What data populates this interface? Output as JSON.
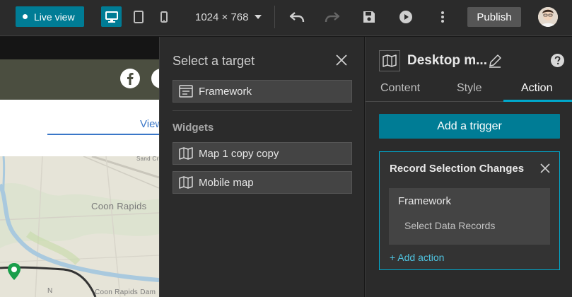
{
  "topbar": {
    "live_view_label": "Live view",
    "screen_size_label": "1024 × 768",
    "publish_label": "Publish"
  },
  "canvas": {
    "nav_link_label": "View",
    "map_labels": {
      "coon_rapids": "Coon Rapids",
      "sand_creek": "Sand Cr",
      "coon_rapids_dam": "Coon Rapids Dam",
      "n_marker": "N"
    }
  },
  "target_panel": {
    "title": "Select a target",
    "framework_item": "Framework",
    "widgets_heading": "Widgets",
    "widgets": [
      {
        "label": "Map 1 copy copy"
      },
      {
        "label": "Mobile map"
      }
    ]
  },
  "settings": {
    "title": "Desktop m...",
    "tabs": [
      {
        "label": "Content"
      },
      {
        "label": "Style"
      },
      {
        "label": "Action"
      }
    ],
    "active_tab": "Action",
    "add_trigger_label": "Add a trigger",
    "trigger": {
      "title": "Record Selection Changes",
      "target": "Framework",
      "action": "Select Data Records",
      "add_action_label": "+ Add action"
    }
  },
  "colors": {
    "accent": "#007c95",
    "accent_bright": "#00a8cc",
    "panel_bg": "#2b2b2b",
    "item_bg": "#444444"
  }
}
